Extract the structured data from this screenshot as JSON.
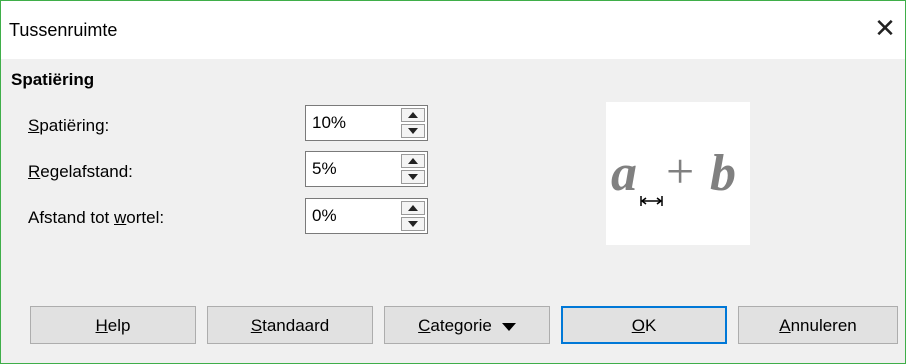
{
  "window": {
    "title": "Tussenruimte",
    "close_glyph": "✕"
  },
  "section": {
    "heading": "Spatiëring"
  },
  "fields": [
    {
      "label_mnemonic": "S",
      "label_rest": "patiëring:",
      "value": "10%"
    },
    {
      "label_mnemonic": "R",
      "label_rest": "egelafstand:",
      "value": "5%"
    },
    {
      "label_pre": "Afstand tot ",
      "label_mnemonic": "w",
      "label_rest": "ortel:",
      "value": "0%"
    }
  ],
  "preview": {
    "left_var": "a",
    "operator": "+",
    "right_var": "b",
    "gap_marker": "spacing-arrow-icon",
    "color": "#808080"
  },
  "buttons": {
    "help": {
      "mnemonic": "H",
      "rest": "elp"
    },
    "default": {
      "mnemonic": "S",
      "rest": "tandaard"
    },
    "category": {
      "mnemonic": "C",
      "rest": "ategorie"
    },
    "ok": {
      "mnemonic": "O",
      "rest": "K"
    },
    "cancel": {
      "mnemonic": "A",
      "rest": "nnuleren"
    }
  },
  "colors": {
    "accent": "#0078d7",
    "window_border": "#3fae49"
  }
}
